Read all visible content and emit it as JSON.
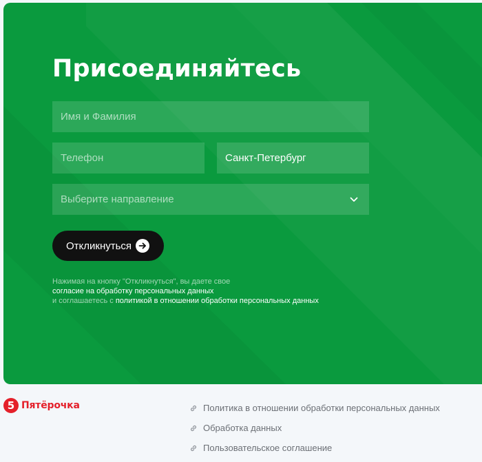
{
  "form": {
    "title": "Присоединяйтесь",
    "name_placeholder": "Имя и Фамилия",
    "phone_placeholder": "Телефон",
    "city_value": "Санкт-Петербург",
    "direction_placeholder": "Выберите направление",
    "submit_label": "Откликнуться",
    "consent": {
      "line1": "Нажимая на кнопку \"Откликнуться\", вы даете свое",
      "link1": "согласие на обработку персональных данных",
      "line3_prefix": "и соглашаетесь с ",
      "link2": "политикой в отношении обработки персональных данных"
    }
  },
  "footer": {
    "logo_digit": "5",
    "logo_text": "Пятёрочка",
    "links": [
      "Политика в отношении обработки персональных данных",
      "Обработка данных",
      "Пользовательское соглашение"
    ]
  },
  "colors": {
    "hero_green": "#0a9a3e",
    "button_black": "#111111",
    "brand_red": "#e4202a"
  },
  "icons": {
    "submit": "arrow-right-icon",
    "select": "chevron-down-icon",
    "footer_link": "link-icon"
  }
}
